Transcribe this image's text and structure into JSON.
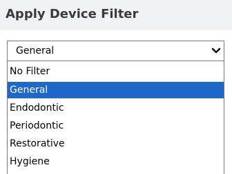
{
  "dialog": {
    "title": "Apply Device Filter"
  },
  "select": {
    "value": "General",
    "icon": "chevron-down-icon"
  },
  "options": [
    {
      "label": "No Filter",
      "selected": false
    },
    {
      "label": "General",
      "selected": true
    },
    {
      "label": "Endodontic",
      "selected": false
    },
    {
      "label": "Periodontic",
      "selected": false
    },
    {
      "label": "Restorative",
      "selected": false
    },
    {
      "label": "Hygiene",
      "selected": false
    }
  ],
  "colors": {
    "selected_background": "#1e68c9",
    "title_background": "#f1f2f4"
  }
}
